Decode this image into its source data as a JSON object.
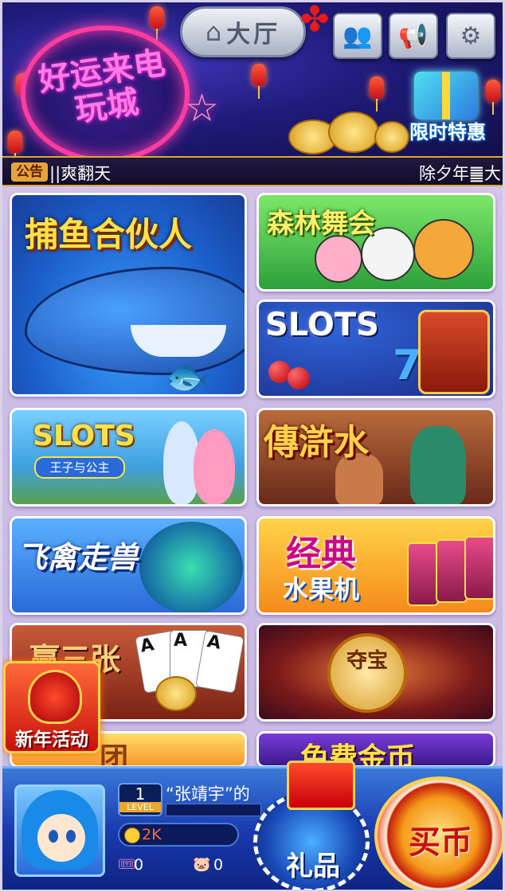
{
  "banner": {
    "logo_text": "好运来电玩城",
    "lobby_label": "大厅",
    "lobby_icon": "home-icon",
    "friends_icon": "friends-icon",
    "announce_icon": "megaphone-icon",
    "settings_icon": "gear-icon",
    "promo_label": "限时特惠"
  },
  "marquee": {
    "tag": "公告",
    "text_left": "||爽翻天",
    "text_right": "除夕年䷀大"
  },
  "games": [
    {
      "title": "捕鱼合伙人"
    },
    {
      "title": "森林舞会"
    },
    {
      "title": "SLOTS"
    },
    {
      "title": "SLOTS",
      "subtitle": "王子与公主"
    },
    {
      "title": "傳滸水"
    },
    {
      "title": "飞禽走兽"
    },
    {
      "title": "经典",
      "subtitle": "水果机"
    },
    {
      "title": "赢三张"
    },
    {
      "title": "夺宝"
    },
    {
      "title": "团"
    },
    {
      "title": "免费金币"
    }
  ],
  "new_year": {
    "label": "新年活动"
  },
  "player": {
    "level": "1",
    "level_label": "LEVEL",
    "name": "“张靖宇”的",
    "coins": "2K",
    "tickets": "0",
    "pigs": "0"
  },
  "buttons": {
    "gift": "礼品",
    "buy": "买币"
  },
  "colors": {
    "banner_bg": "#1f1b7a",
    "accent_gold": "#ffe24a",
    "bottom_bar": "#1a3ab0"
  }
}
